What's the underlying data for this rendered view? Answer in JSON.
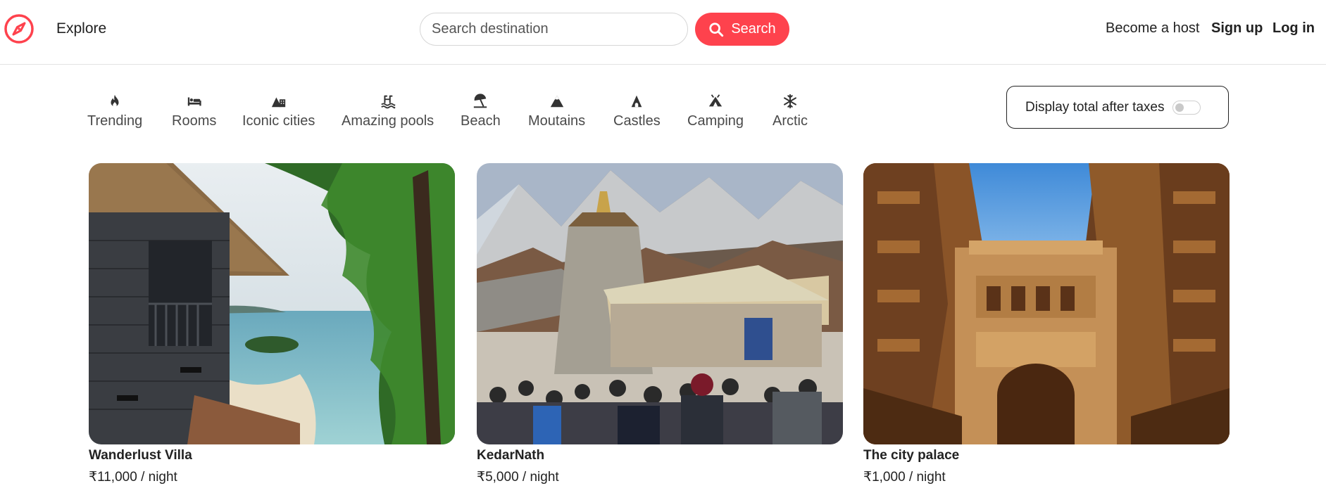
{
  "navbar": {
    "logo_icon": "compass-icon",
    "explore_label": "Explore",
    "search_placeholder": "Search destination",
    "search_button_label": "Search",
    "search_icon": "search-icon",
    "become_host_label": "Become a host",
    "signup_label": "Sign up",
    "login_label": "Log in",
    "accent_color": "#fe424d"
  },
  "filters": [
    {
      "label": "Trending",
      "icon": "fire-icon"
    },
    {
      "label": "Rooms",
      "icon": "bed-icon"
    },
    {
      "label": "Iconic cities",
      "icon": "mountain-city-icon"
    },
    {
      "label": "Amazing pools",
      "icon": "person-swimming-icon"
    },
    {
      "label": "Beach",
      "icon": "umbrella-beach-icon"
    },
    {
      "label": "Moutains",
      "icon": "mountain-icon"
    },
    {
      "label": "Castles",
      "icon": "castle-icon"
    },
    {
      "label": "Camping",
      "icon": "campground-icon"
    },
    {
      "label": "Arctic",
      "icon": "snowflake-icon"
    }
  ],
  "tax_toggle": {
    "label": "Display total after taxes",
    "enabled": false
  },
  "listings": [
    {
      "title": "Wanderlust Villa",
      "price": "₹11,000 / night",
      "image": "villa-beach-photo"
    },
    {
      "title": "KedarNath",
      "price": "₹5,000 / night",
      "image": "temple-mountains-photo"
    },
    {
      "title": "The city palace",
      "price": "₹1,000 / night",
      "image": "palace-courtyard-photo"
    }
  ]
}
